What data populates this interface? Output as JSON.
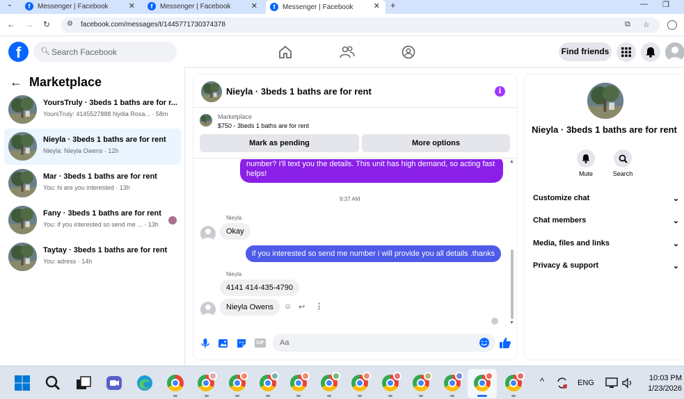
{
  "browser": {
    "tabs": [
      {
        "title": "Messenger | Facebook",
        "active": false
      },
      {
        "title": "Messenger | Facebook",
        "active": false
      },
      {
        "title": "Messenger | Facebook",
        "active": true
      }
    ],
    "url": "facebook.com/messages/t/1445771730374378"
  },
  "header": {
    "search_placeholder": "Search Facebook",
    "find_friends": "Find friends"
  },
  "sidebar": {
    "title": "Marketplace",
    "conversations": [
      {
        "name": "YoursTruly · 3beds 1 baths are for r...",
        "preview": "YoursTruly: 4145527888 Nydia Rosa... · 58m",
        "active": false,
        "unread": false
      },
      {
        "name": "Nieyla · 3beds 1 baths are for rent",
        "preview": "Nieyla: Nieyla Owens · 12h",
        "active": true,
        "unread": false
      },
      {
        "name": "Mar · 3beds 1 baths are for rent",
        "preview": "You: hi are you interested · 13h",
        "active": false,
        "unread": false
      },
      {
        "name": "Fany · 3beds 1 baths are for rent",
        "preview": "You: if you interested so send me ... · 13h",
        "active": false,
        "unread": true
      },
      {
        "name": "Taytay · 3beds 1 baths are for rent",
        "preview": "You: adress · 14h",
        "active": false,
        "unread": false
      }
    ]
  },
  "chat": {
    "title": "Nieyla · 3beds 1 baths are for rent",
    "info_glyph": "i",
    "listing": {
      "label": "Marketplace",
      "price_title": "$750 - 3beds 1 baths are for rent",
      "mark_pending": "Mark as pending",
      "more_options": "More options"
    },
    "messages": {
      "outgoing_long": "number? I'll text you the details. This unit has high demand, so acting fast helps!",
      "timestamp": "9:37 AM",
      "sender1": "Nieyla",
      "in_okay": "Okay",
      "outgoing_2": "if you interested so send me number i will provide you all details .thanks",
      "sender2": "Nieyla",
      "in_phone": "4141 414-435-4790",
      "in_name": "Nieyla Owens"
    },
    "composer_placeholder": "Aa",
    "gif_label": "GIF"
  },
  "details": {
    "name": "Nieyla · 3beds 1 baths are for rent",
    "mute": "Mute",
    "search": "Search",
    "sections": [
      "Customize chat",
      "Chat members",
      "Media, files and links",
      "Privacy & support"
    ]
  },
  "taskbar": {
    "lang": "ENG",
    "time": "10:03 PM",
    "date": "1/23/2026"
  },
  "colors": {
    "fb_blue": "#0866ff",
    "bubble_purple": "#8a20e8",
    "bubble_blue": "#4e5ae8"
  }
}
